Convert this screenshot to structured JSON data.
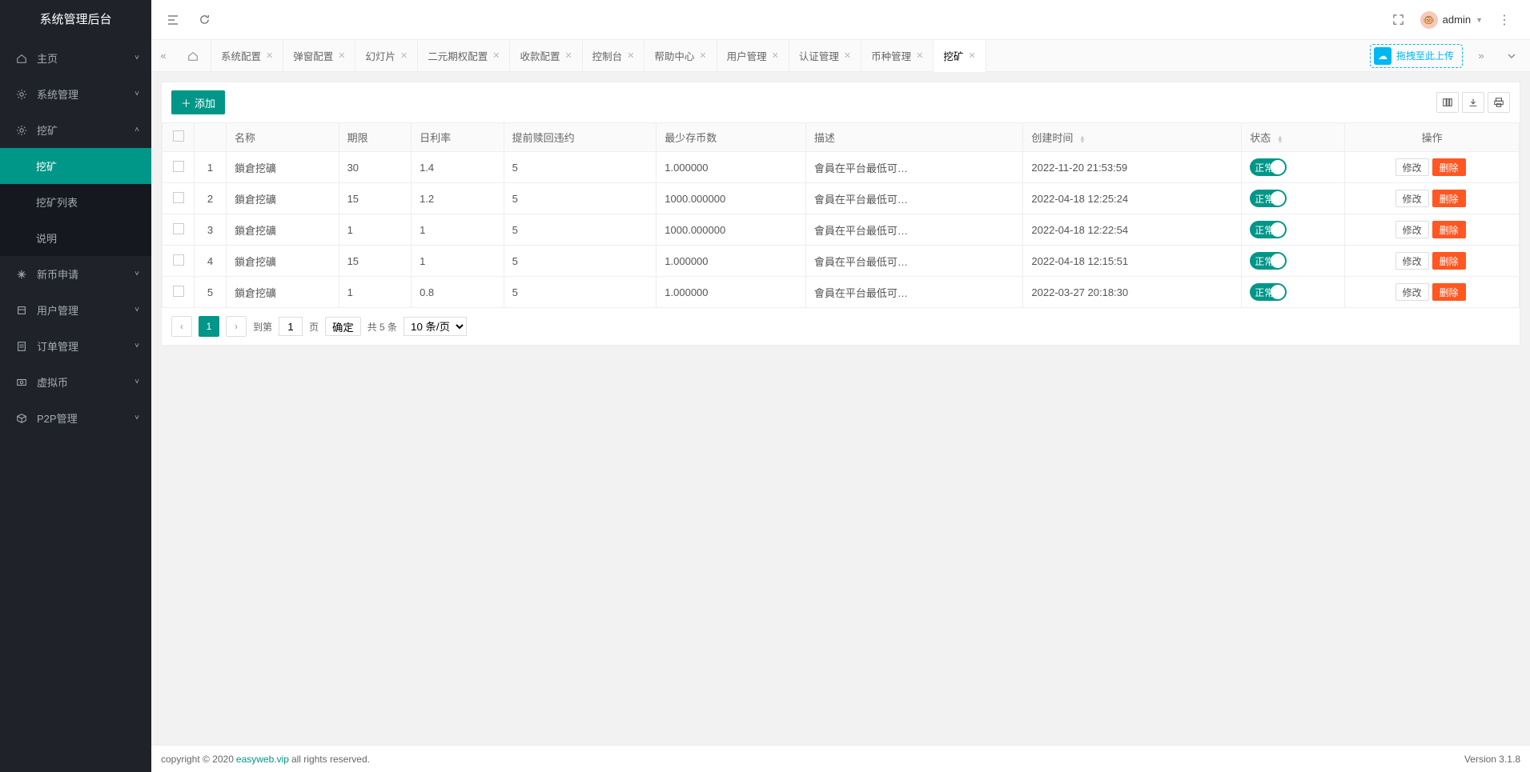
{
  "app_title": "系统管理后台",
  "sidebar": {
    "items": [
      {
        "label": "主页",
        "icon": "home",
        "expandable": true,
        "expanded": false
      },
      {
        "label": "系统管理",
        "icon": "gear",
        "expandable": true,
        "expanded": false
      },
      {
        "label": "挖矿",
        "icon": "gear",
        "expandable": true,
        "expanded": true,
        "children": [
          {
            "label": "挖矿",
            "active": true
          },
          {
            "label": "挖矿列表",
            "active": false
          },
          {
            "label": "说明",
            "active": false
          }
        ]
      },
      {
        "label": "新币申请",
        "icon": "sparkle",
        "expandable": true,
        "expanded": false
      },
      {
        "label": "用户管理",
        "icon": "users",
        "expandable": true,
        "expanded": false
      },
      {
        "label": "订单管理",
        "icon": "orders",
        "expandable": true,
        "expanded": false
      },
      {
        "label": "虚拟币",
        "icon": "coin",
        "expandable": true,
        "expanded": false
      },
      {
        "label": "P2P管理",
        "icon": "cube",
        "expandable": true,
        "expanded": false
      }
    ]
  },
  "header": {
    "user_name": "admin"
  },
  "tabs": {
    "items": [
      {
        "label": "系统配置"
      },
      {
        "label": "弹窗配置"
      },
      {
        "label": "幻灯片"
      },
      {
        "label": "二元期权配置"
      },
      {
        "label": "收款配置"
      },
      {
        "label": "控制台"
      },
      {
        "label": "帮助中心"
      },
      {
        "label": "用户管理"
      },
      {
        "label": "认证管理"
      },
      {
        "label": "币种管理"
      },
      {
        "label": "挖矿",
        "active": true
      }
    ],
    "upload_text": "拖拽至此上传"
  },
  "toolbar": {
    "add_label": "添加"
  },
  "table": {
    "headers": {
      "name": "名称",
      "period": "期限",
      "daily_rate": "日利率",
      "early_penalty": "提前赎回违约",
      "min_deposit": "最少存币数",
      "desc": "描述",
      "created_at": "创建时间",
      "status": "状态",
      "ops": "操作"
    },
    "status_on_text": "正常",
    "edit_label": "修改",
    "delete_label": "删除",
    "rows": [
      {
        "idx": "1",
        "name": "鎖倉挖礦",
        "period": "30",
        "rate": "1.4",
        "penalty": "5",
        "min": "1.000000",
        "desc": "會員在平台最低可鎖…",
        "created": "2022-11-20 21:53:59"
      },
      {
        "idx": "2",
        "name": "鎖倉挖礦",
        "period": "15",
        "rate": "1.2",
        "penalty": "5",
        "min": "1000.000000",
        "desc": "會員在平台最低可鎖…",
        "created": "2022-04-18 12:25:24"
      },
      {
        "idx": "3",
        "name": "鎖倉挖礦",
        "period": "1",
        "rate": "1",
        "penalty": "5",
        "min": "1000.000000",
        "desc": "會員在平台最低可鎖…",
        "created": "2022-04-18 12:22:54"
      },
      {
        "idx": "4",
        "name": "鎖倉挖礦",
        "period": "15",
        "rate": "1",
        "penalty": "5",
        "min": "1.000000",
        "desc": "會員在平台最低可鎖…",
        "created": "2022-04-18 12:15:51"
      },
      {
        "idx": "5",
        "name": "鎖倉挖礦",
        "period": "1",
        "rate": "0.8",
        "penalty": "5",
        "min": "1.000000",
        "desc": "會員在平台最低可鎖…",
        "created": "2022-03-27 20:18:30"
      }
    ]
  },
  "pager": {
    "current": "1",
    "goto_label": "到第",
    "page_suffix": "页",
    "goto_input": "1",
    "confirm": "确定",
    "total_text": "共 5 条",
    "page_size": "10 条/页"
  },
  "footer": {
    "prefix": "copyright © 2020 ",
    "link": "easyweb.vip",
    "suffix": " all rights reserved.",
    "version": "Version 3.1.8"
  }
}
